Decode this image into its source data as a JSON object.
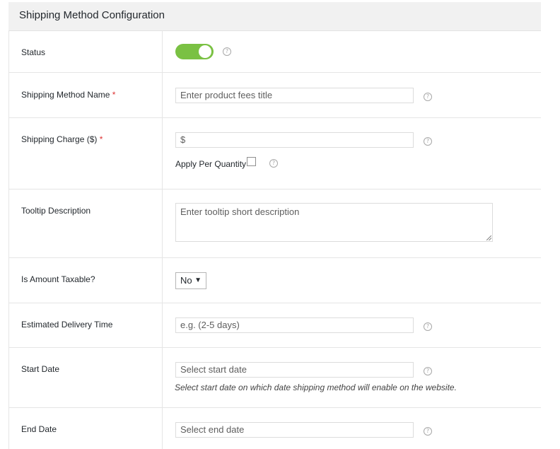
{
  "header": {
    "title": "Shipping Method Configuration"
  },
  "rows": {
    "status": {
      "label": "Status",
      "enabled": true
    },
    "method_name": {
      "label": "Shipping Method Name",
      "required_mark": "*",
      "placeholder": "Enter product fees title"
    },
    "charge": {
      "label": "Shipping Charge ($)",
      "required_mark": "*",
      "value": "$",
      "per_qty_label": "Apply Per Quantity",
      "per_qty_checked": false
    },
    "tooltip": {
      "label": "Tooltip Description",
      "placeholder": "Enter tooltip short description"
    },
    "taxable": {
      "label": "Is Amount Taxable?",
      "selected": "No"
    },
    "delivery": {
      "label": "Estimated Delivery Time",
      "placeholder": "e.g. (2-5 days)"
    },
    "start_date": {
      "label": "Start Date",
      "placeholder": "Select start date",
      "description": "Select start date on which date shipping method will enable on the website."
    },
    "end_date": {
      "label": "End Date",
      "placeholder": "Select end date"
    }
  },
  "help_glyph": "?",
  "colors": {
    "toggle_on": "#7ac143",
    "required": "#dd3333",
    "header_bg": "#f1f1f1"
  }
}
